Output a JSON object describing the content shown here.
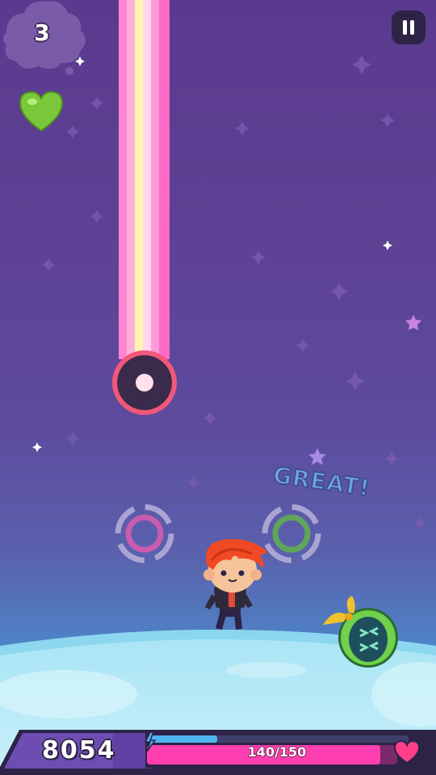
{
  "hud": {
    "combo_count": "3",
    "score": "8054",
    "health_text": "140/150",
    "health_fraction": 0.933,
    "energy_fraction": 0.26
  },
  "feedback": {
    "rating_text": "GREAT!"
  },
  "icons": {
    "pause": "pause-icon",
    "life": "heart-icon",
    "health": "heart-icon",
    "energy": "lightning-icon"
  },
  "colors": {
    "beam_pink": "#ff7fd0",
    "beam_yellow": "#fff4b0",
    "health_bar": "#ff3fb0",
    "energy_bar": "#4fb6f0",
    "note_ring": "#f2577a",
    "life_heart": "#7ac83a"
  }
}
